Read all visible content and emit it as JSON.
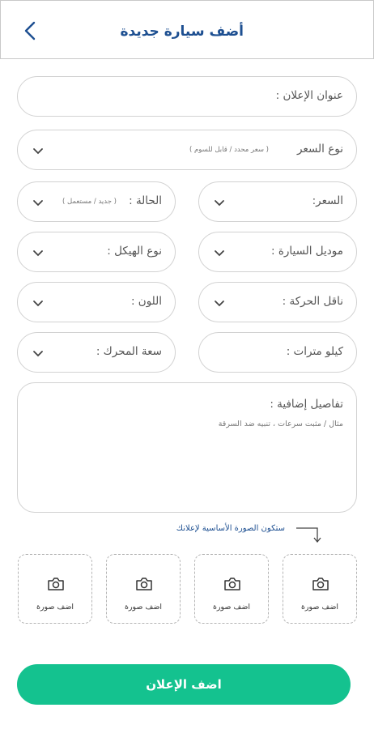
{
  "header": {
    "title": "أضف سيارة جديدة",
    "back_icon": "chevron-left-icon"
  },
  "form": {
    "ad_title": {
      "label": "عنوان الإعلان :"
    },
    "price_type": {
      "label": "نوع السعر",
      "hint": "( سعر محدد / قابل للسوم )"
    },
    "price": {
      "label": "السعر:"
    },
    "condition": {
      "label": "الحالة :",
      "hint": "( جديد / مستعمل )"
    },
    "car_model": {
      "label": "موديل السيارة :"
    },
    "body_type": {
      "label": "نوع الهيكل :"
    },
    "transmission": {
      "label": "ناقل الحركة :"
    },
    "color": {
      "label": "اللون :"
    },
    "kilometers": {
      "label": "كيلو مترات :"
    },
    "engine_capacity": {
      "label": "سعة المحرك :"
    },
    "details": {
      "label": "تفاصيل إضافية :",
      "placeholder": "مثال / مثبت سرعات ، تنبيه ضد السرقة"
    }
  },
  "photos": {
    "main_note": "ستكون الصورة الأساسية لإعلانك",
    "slot_label": "اضف صورة",
    "slot_icon": "camera-icon"
  },
  "submit_label": "اضف الإعلان",
  "colors": {
    "primary_blue": "#1d4f91",
    "accent_green": "#14c28f",
    "border_gray": "#d2d2d2"
  }
}
